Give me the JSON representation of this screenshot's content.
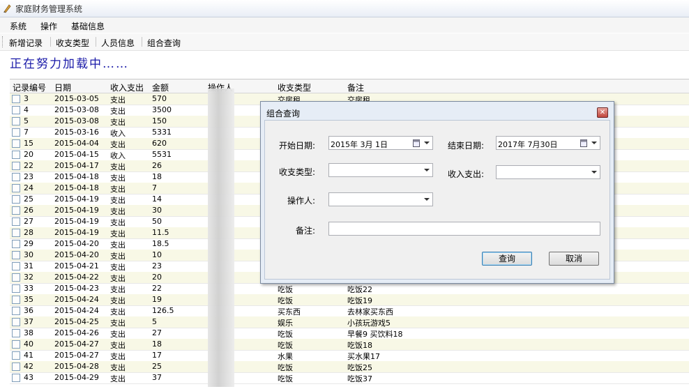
{
  "window": {
    "title": "家庭财务管理系统"
  },
  "menubar": {
    "items": [
      "系统",
      "操作",
      "基础信息"
    ]
  },
  "toolbar": {
    "items": [
      "新增记录",
      "收支类型",
      "人员信息",
      "组合查询"
    ]
  },
  "loading_text": "正在努力加载中……",
  "table": {
    "headers": [
      "记录编号",
      "日期",
      "收入支出",
      "金额",
      "操作人",
      "收支类型",
      "备注"
    ],
    "rows": [
      {
        "id": "3",
        "date": "2015-03-05",
        "io": "支出",
        "amount": "570",
        "type": "交房租",
        "note": "交房租"
      },
      {
        "id": "4",
        "date": "2015-03-08",
        "io": "支出",
        "amount": "3500",
        "type": "",
        "note": ""
      },
      {
        "id": "5",
        "date": "2015-03-08",
        "io": "支出",
        "amount": "150",
        "type": "",
        "note": ""
      },
      {
        "id": "7",
        "date": "2015-03-16",
        "io": "收入",
        "amount": "5331",
        "type": "",
        "note": ""
      },
      {
        "id": "15",
        "date": "2015-04-04",
        "io": "支出",
        "amount": "620",
        "type": "",
        "note": ""
      },
      {
        "id": "20",
        "date": "2015-04-15",
        "io": "收入",
        "amount": "5531",
        "type": "",
        "note": ""
      },
      {
        "id": "22",
        "date": "2015-04-17",
        "io": "支出",
        "amount": "26",
        "type": "",
        "note": ""
      },
      {
        "id": "23",
        "date": "2015-04-18",
        "io": "支出",
        "amount": "18",
        "type": "",
        "note": ""
      },
      {
        "id": "24",
        "date": "2015-04-18",
        "io": "支出",
        "amount": "7",
        "type": "",
        "note": ""
      },
      {
        "id": "25",
        "date": "2015-04-19",
        "io": "支出",
        "amount": "14",
        "type": "",
        "note": ""
      },
      {
        "id": "26",
        "date": "2015-04-19",
        "io": "支出",
        "amount": "30",
        "type": "",
        "note": ""
      },
      {
        "id": "27",
        "date": "2015-04-19",
        "io": "支出",
        "amount": "50",
        "type": "",
        "note": ""
      },
      {
        "id": "28",
        "date": "2015-04-19",
        "io": "支出",
        "amount": "11.5",
        "type": "",
        "note": ""
      },
      {
        "id": "29",
        "date": "2015-04-20",
        "io": "支出",
        "amount": "18.5",
        "type": "",
        "note": ""
      },
      {
        "id": "30",
        "date": "2015-04-20",
        "io": "支出",
        "amount": "10",
        "type": "",
        "note": ""
      },
      {
        "id": "31",
        "date": "2015-04-21",
        "io": "支出",
        "amount": "23",
        "type": "",
        "note": ""
      },
      {
        "id": "32",
        "date": "2015-04-22",
        "io": "支出",
        "amount": "20",
        "type": "",
        "note": ""
      },
      {
        "id": "33",
        "date": "2015-04-23",
        "io": "支出",
        "amount": "22",
        "type": "吃饭",
        "note": "吃饭22"
      },
      {
        "id": "35",
        "date": "2015-04-24",
        "io": "支出",
        "amount": "19",
        "type": "吃饭",
        "note": "吃饭19"
      },
      {
        "id": "36",
        "date": "2015-04-24",
        "io": "支出",
        "amount": "126.5",
        "type": "买东西",
        "note": "去林家买东西"
      },
      {
        "id": "37",
        "date": "2015-04-25",
        "io": "支出",
        "amount": "5",
        "type": "娱乐",
        "note": "小孩玩游戏5"
      },
      {
        "id": "38",
        "date": "2015-04-26",
        "io": "支出",
        "amount": "27",
        "type": "吃饭",
        "note": "早餐9 买饮料18"
      },
      {
        "id": "40",
        "date": "2015-04-27",
        "io": "支出",
        "amount": "18",
        "type": "吃饭",
        "note": "吃饭18"
      },
      {
        "id": "41",
        "date": "2015-04-27",
        "io": "支出",
        "amount": "17",
        "type": "水果",
        "note": "买水果17"
      },
      {
        "id": "42",
        "date": "2015-04-28",
        "io": "支出",
        "amount": "25",
        "type": "吃饭",
        "note": "吃饭25"
      },
      {
        "id": "43",
        "date": "2015-04-29",
        "io": "支出",
        "amount": "37",
        "type": "吃饭",
        "note": "吃饭37"
      }
    ]
  },
  "dialog": {
    "title": "组合查询",
    "start_label": "开始日期:",
    "start_value": "2015年 3月 1日",
    "end_label": "结束日期:",
    "end_value": "2017年 7月30日",
    "type_label": "收支类型:",
    "io_label": "收入支出:",
    "operator_label": "操作人:",
    "note_label": "备注:",
    "query_button": "查询",
    "cancel_button": "取消"
  }
}
